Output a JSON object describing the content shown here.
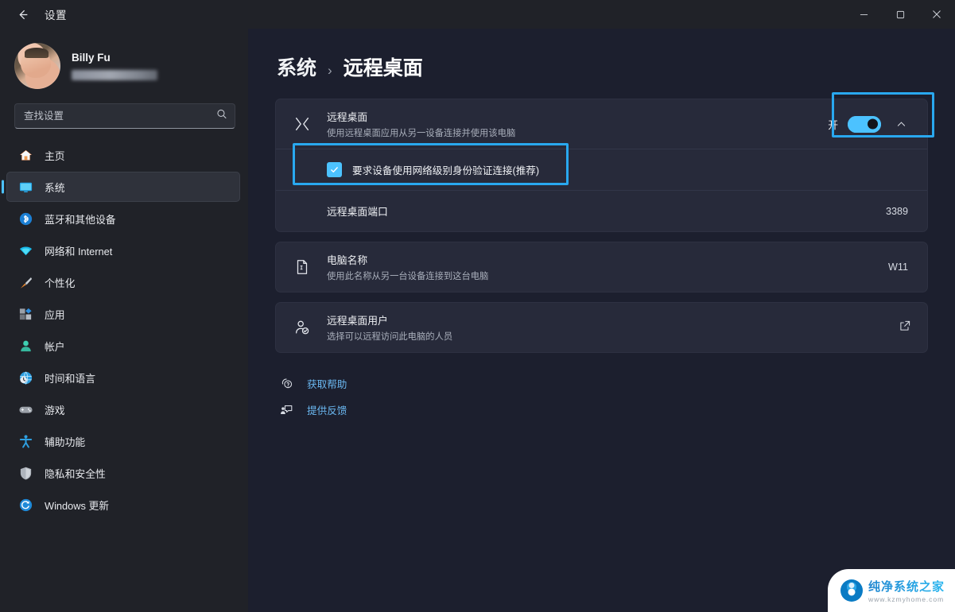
{
  "window": {
    "title": "设置",
    "back_label": "返回",
    "controls": {
      "minimize": "—",
      "maximize": "□",
      "close": "✕"
    }
  },
  "sidebar": {
    "profile": {
      "name": "Billy Fu",
      "email_masked": ""
    },
    "search": {
      "value": "",
      "placeholder": "查找设置",
      "icon": "search-icon"
    },
    "items": [
      {
        "label": "主页",
        "icon": "home-icon",
        "active": false
      },
      {
        "label": "系统",
        "icon": "system-monitor-icon",
        "active": true
      },
      {
        "label": "蓝牙和其他设备",
        "icon": "bluetooth-icon",
        "active": false
      },
      {
        "label": "网络和 Internet",
        "icon": "wifi-icon",
        "active": false
      },
      {
        "label": "个性化",
        "icon": "paintbrush-icon",
        "active": false
      },
      {
        "label": "应用",
        "icon": "apps-icon",
        "active": false
      },
      {
        "label": "帐户",
        "icon": "account-icon",
        "active": false
      },
      {
        "label": "时间和语言",
        "icon": "clock-globe-icon",
        "active": false
      },
      {
        "label": "游戏",
        "icon": "gamepad-icon",
        "active": false
      },
      {
        "label": "辅助功能",
        "icon": "accessibility-icon",
        "active": false
      },
      {
        "label": "隐私和安全性",
        "icon": "shield-icon",
        "active": false
      },
      {
        "label": "Windows 更新",
        "icon": "update-refresh-icon",
        "active": false
      }
    ]
  },
  "breadcrumb": {
    "root": "系统",
    "separator": "›",
    "leaf": "远程桌面"
  },
  "settings": {
    "remote_desktop": {
      "title": "远程桌面",
      "subtitle": "使用远程桌面应用从另一设备连接并使用该电脑",
      "icon": "remote-desktop-icon",
      "toggle_state": "开",
      "toggle_on": true,
      "expand_icon": "chevron-up-icon"
    },
    "nla": {
      "label": "要求设备使用网络级别身份验证连接(推荐)",
      "checked": true
    },
    "port": {
      "title": "远程桌面端口",
      "value": "3389"
    },
    "computer_name": {
      "title": "电脑名称",
      "subtitle": "使用此名称从另一台设备连接到这台电脑",
      "icon": "document-name-icon",
      "value": "W11"
    },
    "users": {
      "title": "远程桌面用户",
      "subtitle": "选择可以远程访问此电脑的人员",
      "icon": "user-check-icon",
      "action_icon": "external-link-icon"
    }
  },
  "links": [
    {
      "label": "获取帮助",
      "icon": "help-question-icon"
    },
    {
      "label": "提供反馈",
      "icon": "feedback-icon"
    }
  ],
  "annotations": {
    "toggle_highlight": {
      "color": "#29a8ef"
    },
    "checkbox_highlight": {
      "color": "#29a8ef"
    }
  },
  "watermark": {
    "title": "纯净系统之家",
    "url": "www.kzmyhome.com"
  }
}
